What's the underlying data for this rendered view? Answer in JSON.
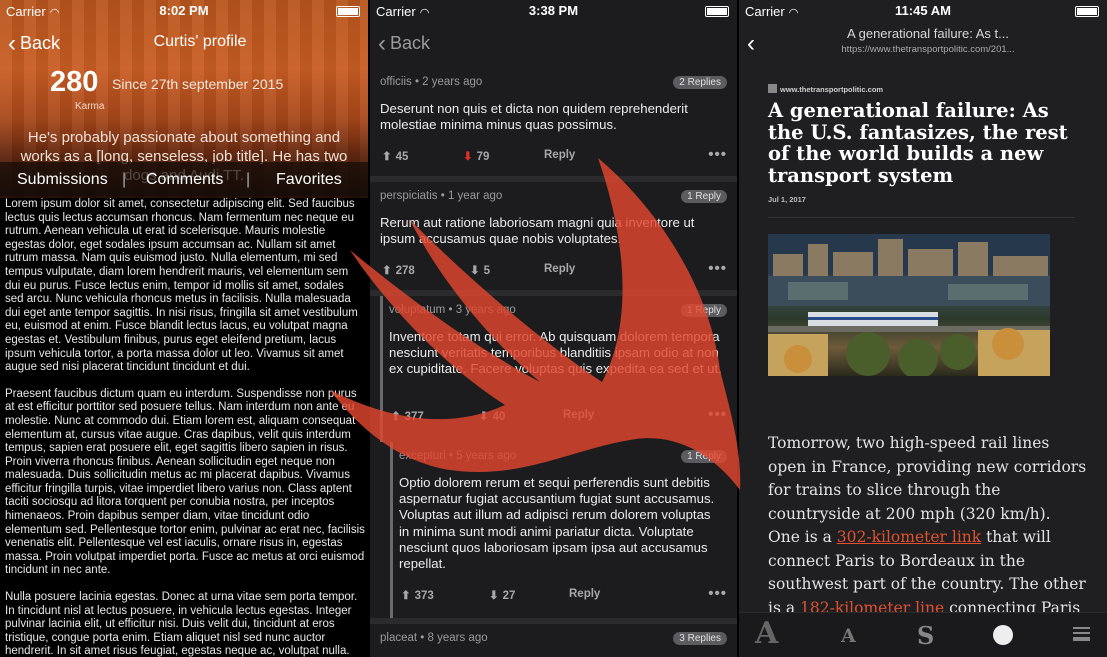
{
  "panel1": {
    "status": {
      "carrier": "Carrier",
      "time": "8:02 PM"
    },
    "nav": {
      "back": "Back",
      "title": "Curtis' profile"
    },
    "karma": {
      "value": "280",
      "since": "Since 27th september 2015",
      "label": "Karma"
    },
    "bio": "He's probably passionate about something and works as a [long, senseless, job title]. He has two dogs and Audi TT.",
    "tabs": [
      "Submissions",
      "Comments",
      "Favorites"
    ],
    "body": [
      "Lorem ipsum dolor sit amet, consectetur adipiscing elit. Sed faucibus lectus quis lectus accumsan rhoncus. Nam fermentum nec neque eu rutrum. Aenean vehicula ut erat id scelerisque. Mauris molestie egestas dolor, eget sodales ipsum accumsan ac. Nullam sit amet rutrum massa. Nam quis euismod justo. Nulla elementum, mi sed tempus vulputate, diam lorem hendrerit mauris, vel elementum sem dui eu purus. Fusce lectus enim, tempor id mollis sit amet, sodales sed arcu. Nunc vehicula rhoncus metus in facilisis. Nulla malesuada dui eget ante tempor sagittis. In nisi risus, fringilla sit amet vestibulum eu, euismod at enim. Fusce blandit lectus lacus, eu volutpat magna egestas et. Vestibulum finibus, purus eget eleifend pretium, lacus ipsum vehicula tortor, a porta massa dolor ut leo. Vivamus sit amet augue sed nisi placerat tincidunt tincidunt et dui.",
      "Praesent faucibus dictum quam eu interdum. Suspendisse non purus at est efficitur porttitor sed posuere tellus. Nam interdum non ante eu molestie. Nunc at commodo dui. Etiam lorem est, aliquam consequat elementum at, cursus vitae augue. Cras dapibus, velit quis interdum tempus, sapien erat posuere elit, eget sagittis libero sapien in risus. Proin viverra rhoncus finibus. Aenean sollicitudin eget neque non malesuada. Duis sollicitudin metus ac mi placerat dapibus. Vivamus efficitur fringilla turpis, vitae imperdiet libero varius non. Class aptent taciti sociosqu ad litora torquent per conubia nostra, per inceptos himenaeos. Proin dapibus semper diam, vitae tincidunt odio elementum sed. Pellentesque tortor enim, pulvinar ac erat nec, facilisis venenatis elit. Pellentesque vel est iaculis, ornare risus in, egestas massa. Proin volutpat imperdiet porta. Fusce ac metus at orci euismod tincidunt in nec ante.",
      "Nulla posuere lacinia egestas. Donec at urna vitae sem porta tempor. In tincidunt nisl at lectus posuere, in vehicula lectus egestas. Integer pulvinar lacinia elit, ut efficitur nisi. Duis velit dui, tincidunt at eros tristique, congue porta enim. Etiam aliquet nisl sed nunc auctor hendrerit. In sit amet risus feugiat, egestas neque ac, volutpat nulla."
    ]
  },
  "panel2": {
    "status": {
      "carrier": "Carrier",
      "time": "3:38 PM"
    },
    "nav": {
      "back": "Back"
    },
    "comments": [
      {
        "author": "officiis",
        "age": "2 years ago",
        "replies": "2 Replies",
        "text": "Deserunt non quis et dicta non quidem reprehenderit molestiae minima minus quas possimus.",
        "up": "45",
        "down": "79",
        "reply": "Reply"
      },
      {
        "author": "perspiciatis",
        "age": "1 year ago",
        "replies": "1 Reply",
        "text": "Rerum aut ratione laboriosam magni quia inventore ut ipsum accusamus quae nobis voluptates.",
        "up": "278",
        "down": "5",
        "reply": "Reply"
      },
      {
        "author": "voluptatum",
        "age": "3 years ago",
        "replies": "1 Reply",
        "text": "Inventore totam qui error. Ab quisquam dolorem tempora nesciunt veritatis temporibus blanditiis ipsam odio at non ex cupiditate. Facere voluptas quis expedita ea sed et ut.",
        "up": "377",
        "down": "40",
        "reply": "Reply"
      },
      {
        "author": "excepturi",
        "age": "5 years ago",
        "replies": "1 Reply",
        "text": "Optio dolorem rerum et sequi perferendis sunt debitis aspernatur fugiat accusantium fugiat sunt accusamus. Voluptas aut illum ad adipisci rerum dolorem voluptas in minima sunt modi animi pariatur dicta. Voluptate nesciunt quos laboriosam ipsam ipsa aut accusamus repellat.",
        "up": "373",
        "down": "27",
        "reply": "Reply"
      },
      {
        "author": "placeat",
        "age": "8 years ago",
        "replies": "3 Replies"
      }
    ],
    "more": "•••"
  },
  "panel3": {
    "status": {
      "carrier": "Carrier",
      "time": "11:45 AM"
    },
    "nav": {
      "title": "A generational failure: As t...",
      "url": "https://www.thetransportpolitic.com/201..."
    },
    "site": "www.thetransportpolitic.com",
    "headline": "A generational failure: As the U.S. fantasizes, the rest of the world builds a new transport system",
    "date": "Jul 1, 2017",
    "body": {
      "p1": "Tomorrow, two high-speed rail lines open in France, providing new corridors for trains to slice through the countryside at 200 mph (320 km/h). One is a ",
      "link1": "302-kilometer link",
      "p2": " that will connect Paris to Bordeaux in the southwest part of the country. The other is a ",
      "link2": "182-kilometer line",
      "p3": " connecting Paris to western France. They'll provide riders the"
    },
    "toolbar": {
      "font_large": "A",
      "font_small": "A",
      "serif": "S"
    },
    "colors": {
      "link": "#e2512f",
      "swift": "#e0472e"
    }
  }
}
